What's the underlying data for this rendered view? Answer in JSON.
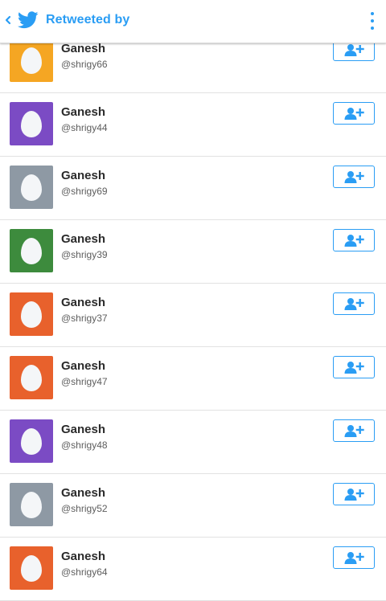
{
  "header": {
    "title": "Retweeted by"
  },
  "users": [
    {
      "name": "Ganesh",
      "handle": "@shrigy66",
      "color": "#f5a623"
    },
    {
      "name": "Ganesh",
      "handle": "@shrigy44",
      "color": "#7b4bc4"
    },
    {
      "name": "Ganesh",
      "handle": "@shrigy69",
      "color": "#8e99a4"
    },
    {
      "name": "Ganesh",
      "handle": "@shrigy39",
      "color": "#3d8b3d"
    },
    {
      "name": "Ganesh",
      "handle": "@shrigy37",
      "color": "#e8612c"
    },
    {
      "name": "Ganesh",
      "handle": "@shrigy47",
      "color": "#e8612c"
    },
    {
      "name": "Ganesh",
      "handle": "@shrigy48",
      "color": "#7b4bc4"
    },
    {
      "name": "Ganesh",
      "handle": "@shrigy52",
      "color": "#8e99a4"
    },
    {
      "name": "Ganesh",
      "handle": "@shrigy64",
      "color": "#e8612c"
    }
  ],
  "icons": {
    "back": "chevron-left-icon",
    "logo": "twitter-bird-icon",
    "menu": "overflow-menu-icon",
    "follow": "add-user-icon",
    "avatar": "default-egg-avatar"
  },
  "colors": {
    "accent": "#2a9df4"
  }
}
